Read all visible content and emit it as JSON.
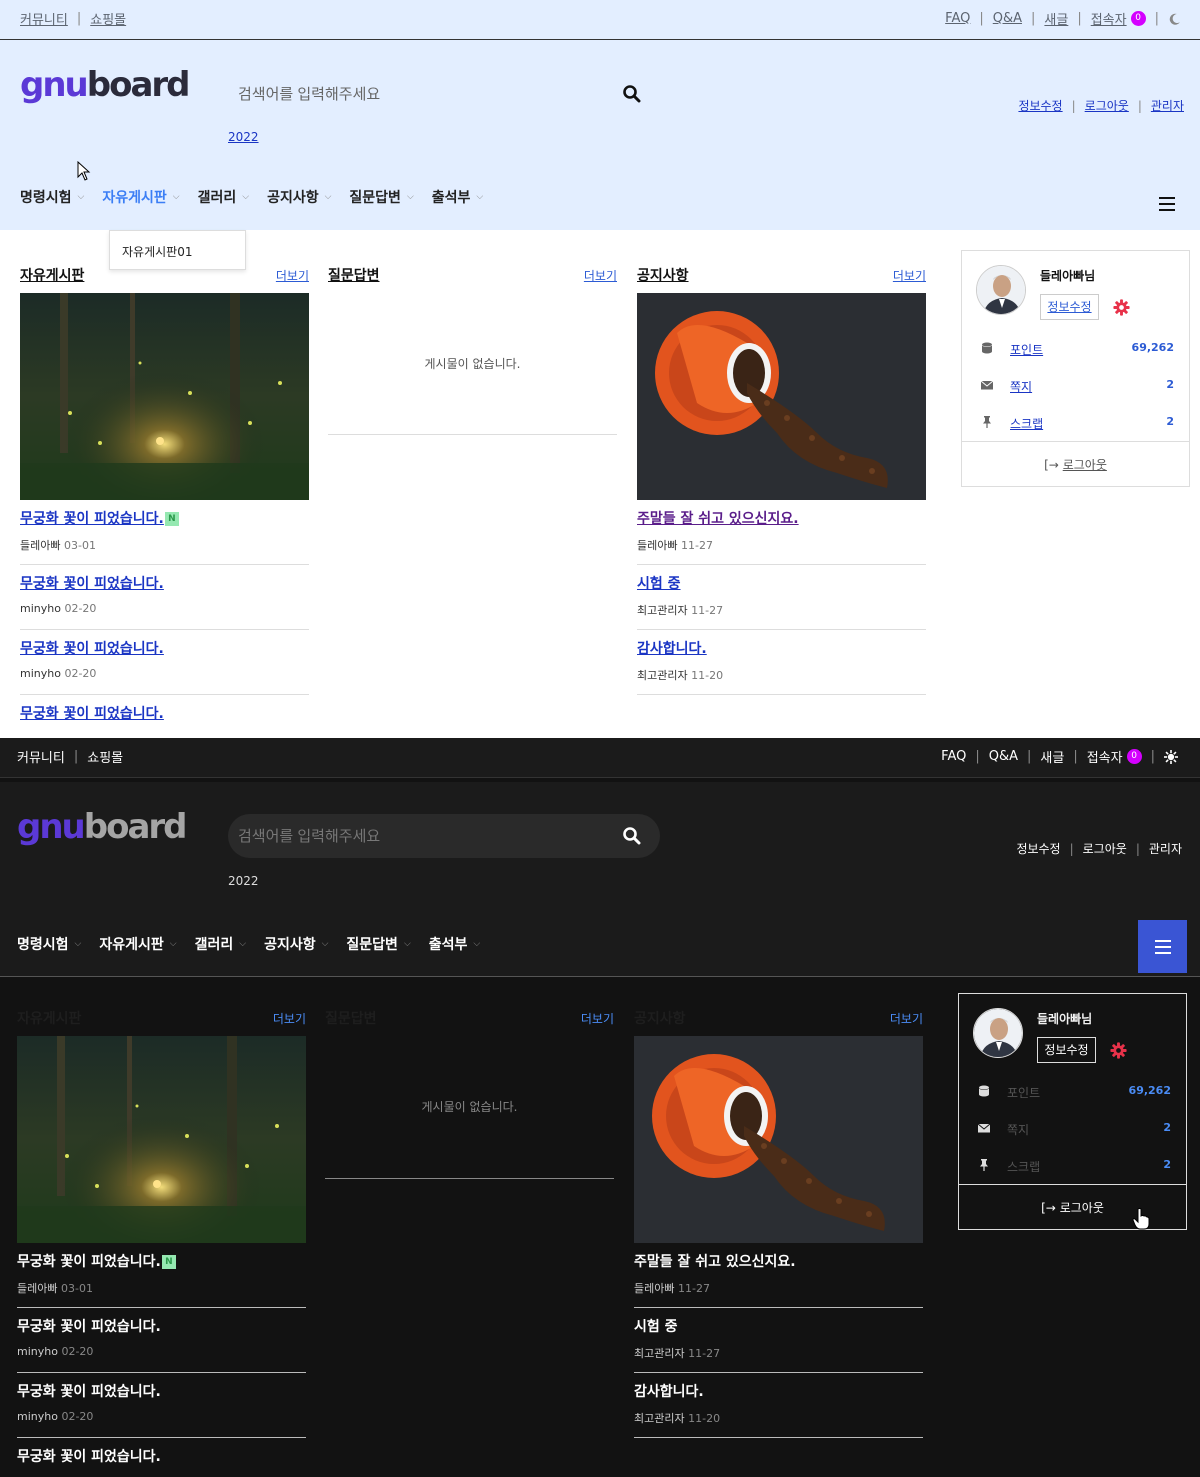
{
  "topbar": {
    "left_links": [
      "커뮤니티",
      "쇼핑몰"
    ],
    "right_links": [
      "FAQ",
      "Q&A",
      "새글",
      "접속자"
    ],
    "visitor_count": "0"
  },
  "header": {
    "logo_part1": "gnu",
    "logo_part2": "board",
    "search_placeholder": "검색어를 입력해주세요",
    "popular_keyword": "2022",
    "links": [
      "정보수정",
      "로그아웃",
      "관리자"
    ]
  },
  "nav": {
    "items": [
      "명령시험",
      "자유게시판",
      "갤러리",
      "공지사항",
      "질문답변",
      "출석부"
    ],
    "dropdown_item": "자유게시판01"
  },
  "more_label": "더보기",
  "columns": [
    {
      "title": "자유게시판",
      "posts": [
        {
          "title": "무궁화 꽃이 피었습니다.",
          "author": "들레아빠",
          "date": "03-01",
          "new": "N"
        },
        {
          "title": "무궁화 꽃이 피었습니다.",
          "author": "minyho",
          "date": "02-20"
        },
        {
          "title": "무궁화 꽃이 피었습니다.",
          "author": "minyho",
          "date": "02-20"
        },
        {
          "title": "무궁화 꽃이 피었습니다."
        }
      ]
    },
    {
      "title": "질문답변",
      "empty_text": "게시물이 없습니다."
    },
    {
      "title": "공지사항",
      "posts": [
        {
          "title": "주말들 잘 쉬고 있으신지요.",
          "author": "들레아빠",
          "date": "11-27"
        },
        {
          "title": "시험 중",
          "author": "최고관리자",
          "date": "11-27"
        },
        {
          "title": "감사합니다.",
          "author": "최고관리자",
          "date": "11-20"
        }
      ]
    }
  ],
  "profile": {
    "name": "들레아빠님",
    "edit_label": "정보수정",
    "rows": [
      {
        "label": "포인트",
        "value": "69,262",
        "icon": "database-icon"
      },
      {
        "label": "쪽지",
        "value": "2",
        "icon": "envelope-icon"
      },
      {
        "label": "스크랩",
        "value": "2",
        "icon": "thumbtack-icon"
      }
    ],
    "logout_label": "로그아웃"
  },
  "colors": {
    "light_header_bg": "#e3eeff",
    "dark_bg": "#121212",
    "dark_header_bg": "#1b1b1b",
    "accent_blue": "#3a55d4",
    "logo_purple": "#5b39d6",
    "badge_purple": "#d400ff",
    "new_badge_green": "#95e8b1",
    "gear_red": "#e8324a"
  }
}
